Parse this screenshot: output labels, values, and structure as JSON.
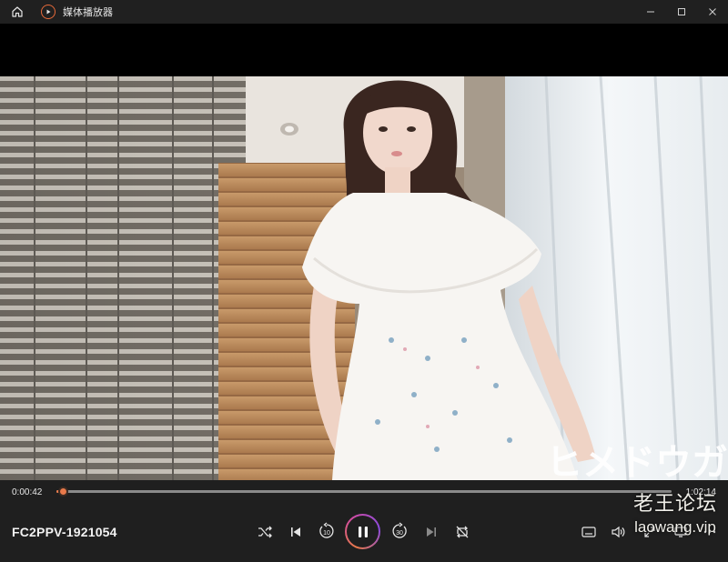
{
  "app": {
    "title": "媒体播放器",
    "accent": "#e8794a"
  },
  "titlebar": {
    "icons": [
      "home-icon",
      "app-icon",
      "minimize-icon",
      "maximize-icon",
      "close-icon"
    ]
  },
  "playback": {
    "current_time": "0:00:42",
    "total_time": "1:02:14",
    "progress": 0.011,
    "media_title": "FC2PPV-1921054",
    "state": "playing"
  },
  "controls": {
    "icons": [
      "shuffle-icon",
      "previous-icon",
      "rewind-10-icon",
      "pause-icon",
      "forward-30-icon",
      "next-icon",
      "repeat-icon",
      "captions-icon",
      "volume-icon",
      "fullscreen-icon",
      "cast-icon",
      "more-icon"
    ],
    "rewind_label": "10",
    "forward_label": "30"
  },
  "video": {
    "overlay_text": "ヒメドウガ"
  },
  "watermark": {
    "line1": "老王论坛",
    "line2": "laowang.vip"
  }
}
